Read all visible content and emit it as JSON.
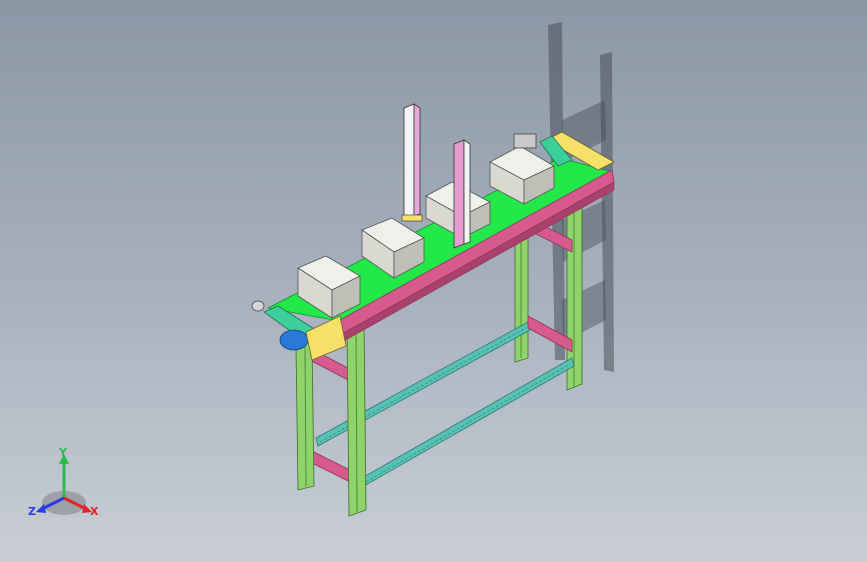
{
  "viewport": {
    "model": "belt-conveyor-assembly",
    "colors": {
      "belt": "#23e84a",
      "rail": "#d65a8c",
      "rail_dark": "#a8416b",
      "frame_leg": "#8fd36a",
      "frame_leg_dark": "#4d8c3a",
      "crossbar": "#57c2b3",
      "box": "#e6e6df",
      "box_side": "#c6c6be",
      "motor_cover": "#f5e06a",
      "motor": "#2b78d8",
      "end_roller": "#3ccf9c",
      "guide_post": "#e79cd0",
      "guide_post_left": "#f4f4f4",
      "shadow": "#2c323b"
    }
  },
  "triad": {
    "x_label": "X",
    "y_label": "Y",
    "z_label": "Z",
    "x_color": "#e0242c",
    "y_color": "#2fb84b",
    "z_color": "#2a3ce0"
  }
}
